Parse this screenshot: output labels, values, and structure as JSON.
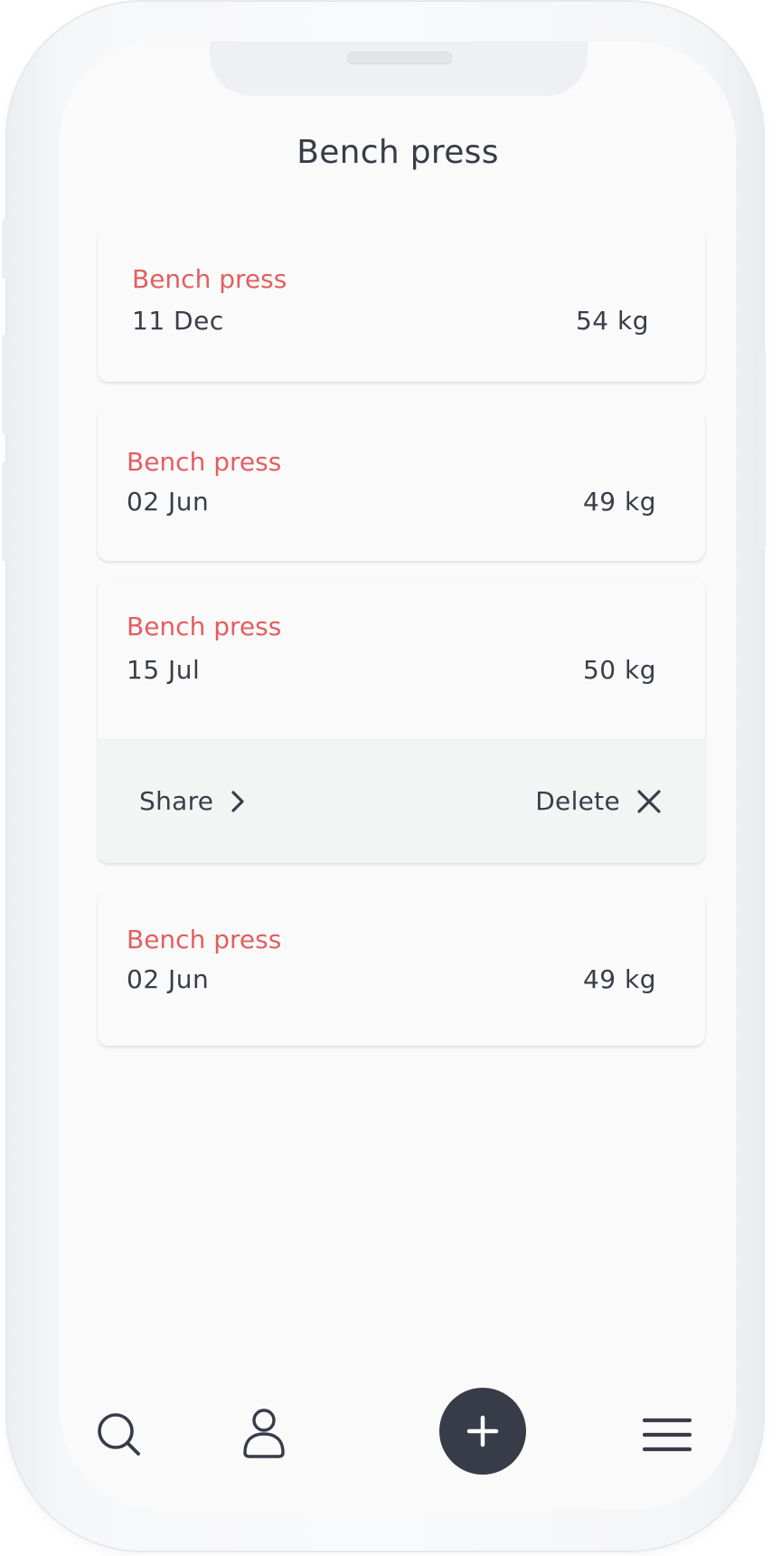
{
  "header": {
    "title": "Bench press"
  },
  "records": [
    {
      "title": "Bench press",
      "date": "11 Dec",
      "weight": "54 kg"
    },
    {
      "title": "Bench press",
      "date": "02 Jun",
      "weight": "49 kg"
    },
    {
      "title": "Bench press",
      "date": "15 Jul",
      "weight": "50 kg"
    },
    {
      "title": "Bench press",
      "date": "02 Jun",
      "weight": "49 kg"
    }
  ],
  "actions": {
    "share_label": "Share",
    "delete_label": "Delete"
  },
  "bottom_nav": {
    "items": [
      {
        "icon": "search-icon"
      },
      {
        "icon": "profile-icon"
      },
      {
        "icon": "add-icon"
      },
      {
        "icon": "menu-icon"
      }
    ]
  },
  "colors": {
    "accent": "#e45e60",
    "text": "#3a3d4a",
    "fab": "#383b48",
    "background": "#fafafa"
  }
}
